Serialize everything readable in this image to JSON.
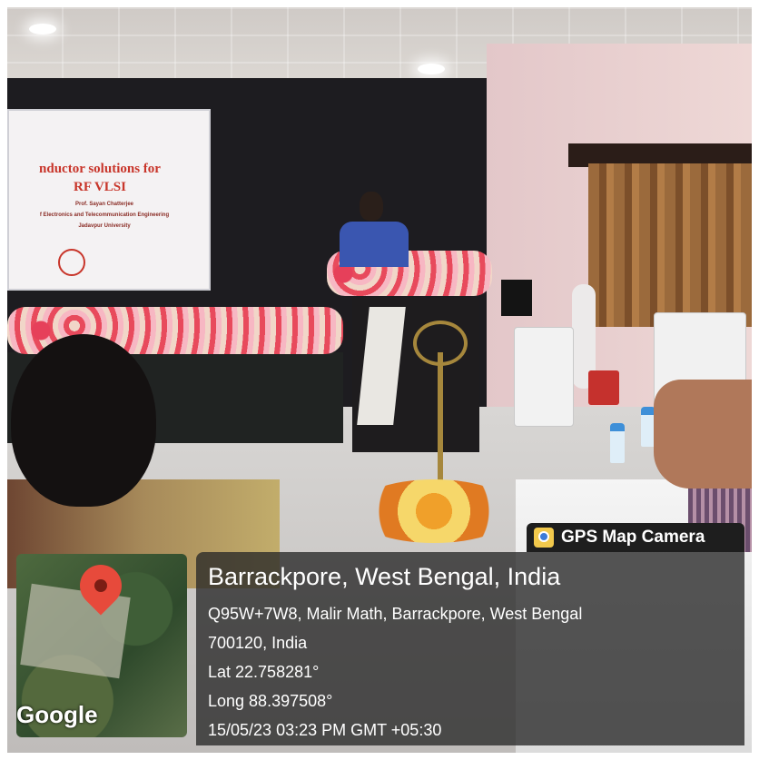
{
  "slide": {
    "title_line1": "nductor solutions for",
    "title_line2": "RF VLSI",
    "presenter": "Prof. Sayan Chatterjee",
    "department": "f Electronics and Telecommunication Engineering",
    "university": "Jadavpur University"
  },
  "overlay": {
    "app_label": "GPS Map Camera",
    "place": "Barrackpore, West Bengal, India",
    "address_line1": "Q95W+7W8, Malir Math, Barrackpore, West Bengal",
    "address_line2": "700120, India",
    "lat": "Lat 22.758281°",
    "long": "Long 88.397508°",
    "timestamp": "15/05/23 03:23 PM GMT +05:30",
    "map_brand": "Google"
  },
  "icons": {
    "app_icon": "gps-map-camera-icon",
    "pin_icon": "location-pin-icon"
  },
  "colors": {
    "panel": "#282828",
    "pin": "#e74a3b",
    "slide_title": "#c8352a"
  }
}
